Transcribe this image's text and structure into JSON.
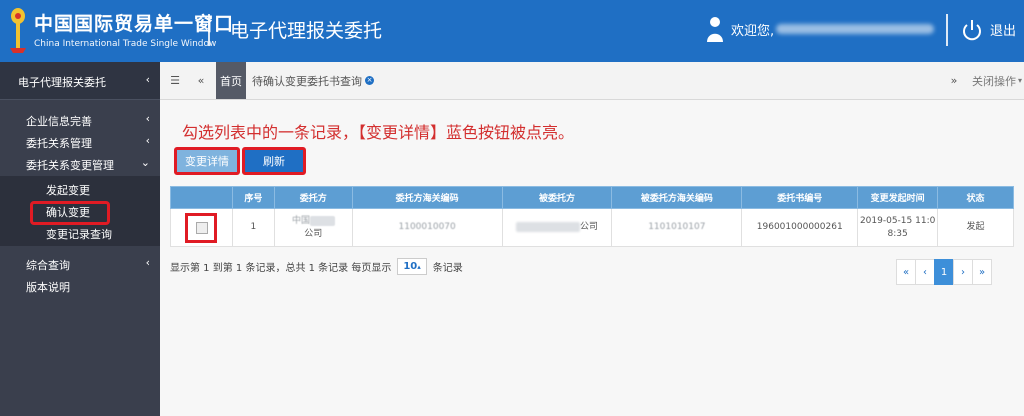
{
  "header": {
    "brand_cn": "中国国际贸易单一窗口",
    "brand_en": "China International Trade Single Window",
    "app_title": "电子代理报关委托",
    "welcome": "欢迎您,",
    "logout": "退出"
  },
  "sidebar": {
    "top": "电子代理报关委托",
    "items": [
      {
        "label": "企业信息完善"
      },
      {
        "label": "委托关系管理"
      },
      {
        "label": "委托关系变更管理"
      },
      {
        "label": "发起变更"
      },
      {
        "label": "确认变更"
      },
      {
        "label": "变更记录查询"
      },
      {
        "label": "综合查询"
      },
      {
        "label": "版本说明"
      }
    ]
  },
  "tabbar": {
    "home": "首页",
    "tab": "待确认变更委托书查询",
    "close_ops": "关闭操作"
  },
  "annotation": "勾选列表中的一条记录，【变更详情】蓝色按钮被点亮。",
  "toolbar": {
    "detail": "变更详情",
    "refresh": "刷新"
  },
  "table": {
    "columns": [
      "序号",
      "委托方",
      "委托方海关编码",
      "被委托方",
      "被委托方海关编码",
      "委托书编号",
      "变更发起时间",
      "状态"
    ],
    "rows": [
      {
        "seq": "1",
        "client_a": "中国",
        "client_b": "公司",
        "client_code": "1100010070",
        "agent": "公司",
        "agent_code": "1101010107",
        "book_no": "196001000000261",
        "time_a": "2019-05-15 11:0",
        "time_b": "8:35",
        "status": "发起"
      }
    ]
  },
  "pager": {
    "info": "显示第 1 到第 1 条记录，总共 1 条记录 每页显示",
    "size": "10",
    "unit": "条记录",
    "first": "«",
    "prev": "‹",
    "current": "1",
    "next": "›",
    "last": "»"
  },
  "colors": {
    "header_bg": "#1f6fc4",
    "sidebar_bg": "#3a3f4d",
    "table_header": "#5d9ed3",
    "highlight": "#e01b24"
  }
}
